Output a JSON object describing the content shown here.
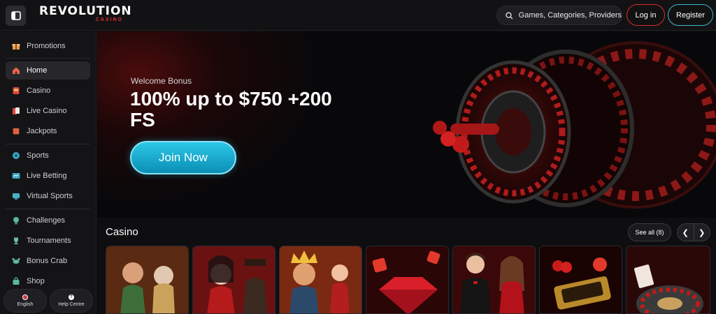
{
  "header": {
    "logo_main": "REVOLUTION",
    "logo_sub": "CASINO",
    "search_placeholder": "Games, Categories, Providers",
    "login_label": "Log in",
    "register_label": "Register"
  },
  "sidebar": {
    "items": [
      {
        "label": "Promotions",
        "icon": "gift-icon"
      },
      {
        "label": "Home",
        "icon": "home-icon",
        "active": true
      },
      {
        "label": "Casino",
        "icon": "slot-icon"
      },
      {
        "label": "Live Casino",
        "icon": "cards-icon"
      },
      {
        "label": "Jackpots",
        "icon": "clover-icon"
      },
      {
        "label": "Sports",
        "icon": "football-icon"
      },
      {
        "label": "Live Betting",
        "icon": "live-icon"
      },
      {
        "label": "Virtual Sports",
        "icon": "virtual-icon"
      },
      {
        "label": "Challenges",
        "icon": "badge-icon"
      },
      {
        "label": "Tournaments",
        "icon": "trophy-icon"
      },
      {
        "label": "Bonus Crab",
        "icon": "crab-icon"
      },
      {
        "label": "Shop",
        "icon": "shop-icon"
      }
    ],
    "footer": {
      "language_label": "English",
      "help_label": "Help Centre"
    }
  },
  "hero": {
    "subtitle": "Welcome Bonus",
    "title": "100% up to $750 +200 FS",
    "cta_label": "Join Now"
  },
  "casino": {
    "title": "Casino",
    "see_all_label": "See all (8)"
  },
  "colors": {
    "accent_red": "#d92b2b",
    "accent_cyan": "#2cc7e6",
    "background": "#0e0e10"
  }
}
